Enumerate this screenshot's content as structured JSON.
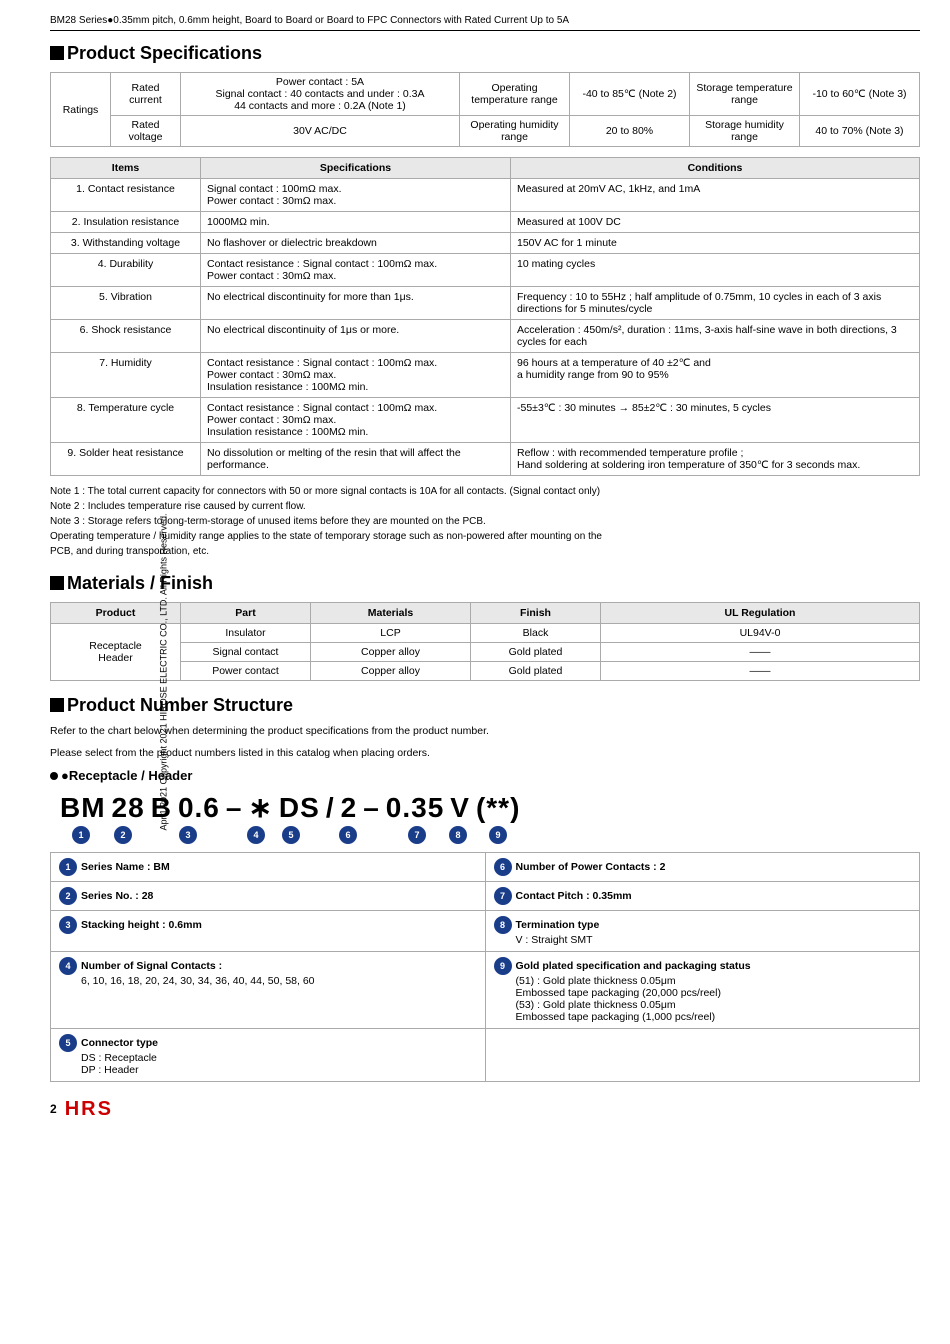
{
  "header": {
    "title": "BM28 Series●0.35mm pitch, 0.6mm height, Board to Board or Board to FPC Connectors with Rated Current Up to 5A"
  },
  "sidebar": {
    "text": "Apr.1.2021 Copyright 2021 HIROSE ELECTRIC CO., LTD. All Rights Reserved."
  },
  "product_specs": {
    "section_title": "Product Specifications",
    "ratings": {
      "rows": [
        {
          "label1": "Rated current",
          "val1": "Power contact : 5A\nSignal contact : 40 contacts and under : 0.3A\n44 contacts and more : 0.2A (Note 1)",
          "label2": "Operating temperature range",
          "val2": "-40 to 85℃ (Note 2)",
          "label3": "Storage temperature range",
          "val3": "-10 to 60℃ (Note 3)"
        },
        {
          "label1": "Rated voltage",
          "val1": "30V AC/DC",
          "label2": "Operating humidity range",
          "val2": "20 to 80%",
          "label3": "Storage humidity range",
          "val3": "40 to 70% (Note 3)"
        }
      ]
    },
    "specs_headers": [
      "Items",
      "Specifications",
      "Conditions"
    ],
    "specs_rows": [
      {
        "item": "1. Contact resistance",
        "spec": "Signal contact : 100mΩ max.\nPower contact : 30mΩ max.",
        "cond": "Measured at 20mV AC, 1kHz, and 1mA"
      },
      {
        "item": "2. Insulation resistance",
        "spec": "1000MΩ min.",
        "cond": "Measured at 100V DC"
      },
      {
        "item": "3. Withstanding voltage",
        "spec": "No flashover or dielectric breakdown",
        "cond": "150V AC for 1 minute"
      },
      {
        "item": "4. Durability",
        "spec": "Contact resistance : Signal contact : 100mΩ max.\nPower contact : 30mΩ max.",
        "cond": "10 mating cycles"
      },
      {
        "item": "5. Vibration",
        "spec": "No electrical discontinuity for more than 1μs.",
        "cond": "Frequency : 10 to 55Hz ; half amplitude of 0.75mm, 10 cycles in each of 3 axis directions for 5 minutes/cycle"
      },
      {
        "item": "6. Shock resistance",
        "spec": "No electrical discontinuity of 1μs or more.",
        "cond": "Acceleration : 450m/s², duration : 11ms, 3-axis half-sine wave in both directions, 3 cycles for each"
      },
      {
        "item": "7. Humidity",
        "spec": "Contact resistance : Signal contact : 100mΩ max.\nPower contact : 30mΩ max.\nInsulation resistance : 100MΩ min.",
        "cond": "96 hours at a temperature of 40 ±2℃ and\na humidity range from 90 to 95%"
      },
      {
        "item": "8. Temperature cycle",
        "spec": "Contact resistance : Signal contact : 100mΩ max.\nPower contact : 30mΩ max.\nInsulation resistance : 100MΩ min.",
        "cond": "-55±3℃ : 30 minutes → 85±2℃ : 30 minutes, 5 cycles"
      },
      {
        "item": "9. Solder heat resistance",
        "spec": "No dissolution or melting of the resin that will affect the performance.",
        "cond": "Reflow : with recommended temperature profile ;\nHand soldering at soldering iron temperature of 350℃ for 3 seconds max."
      }
    ],
    "notes": [
      "Note 1 : The total current capacity for connectors with 50 or more signal contacts is 10A for all contacts. (Signal contact only)",
      "Note 2 : Includes temperature rise caused by current flow.",
      "Note 3 : Storage refers to long-term-storage of unused items before they are mounted on the PCB.",
      "          Operating temperature / humidity range applies to the state of temporary storage such as non-powered after mounting on the",
      "          PCB, and during transportation, etc."
    ]
  },
  "materials": {
    "section_title": "Materials / Finish",
    "headers": [
      "Product",
      "Part",
      "Materials",
      "Finish",
      "UL Regulation"
    ],
    "product_label": "Receptacle\nHeader",
    "rows": [
      {
        "part": "Insulator",
        "materials": "LCP",
        "finish": "Black",
        "ul": "UL94V-0"
      },
      {
        "part": "Signal contact",
        "materials": "Copper alloy",
        "finish": "Gold plated",
        "ul": "——"
      },
      {
        "part": "Power contact",
        "materials": "Copper alloy",
        "finish": "Gold plated",
        "ul": "——"
      }
    ]
  },
  "product_number": {
    "section_title": "Product Number Structure",
    "desc1": "Refer to the chart below when determining the product specifications from the product number.",
    "desc2": "Please select from the product numbers listed in this catalog when placing orders.",
    "receptacle_label": "●Receptacle / Header",
    "part_number_parts": [
      "BM",
      "28",
      "B",
      "0.6",
      "–",
      "*",
      "DS",
      "/",
      "2",
      "–",
      "0.35",
      "V",
      "(**)"
    ],
    "circle_positions": [
      {
        "num": "1",
        "segment": "BM"
      },
      {
        "num": "2",
        "segment": "28"
      },
      {
        "num": "3",
        "segment": "B 0.6"
      },
      {
        "num": "4",
        "segment": "*"
      },
      {
        "num": "5",
        "segment": "DS"
      },
      {
        "num": "6",
        "segment": "2"
      },
      {
        "num": "7",
        "segment": "0.35"
      },
      {
        "num": "8",
        "segment": "V"
      },
      {
        "num": "9",
        "segment": "(**)"
      }
    ],
    "descriptions": [
      {
        "num": "1",
        "label": "Series Name : BM"
      },
      {
        "num": "6",
        "label": "Number of Power Contacts : 2"
      },
      {
        "num": "2",
        "label": "Series No. : 28"
      },
      {
        "num": "7",
        "label": "Contact Pitch : 0.35mm"
      },
      {
        "num": "3",
        "label": "Stacking height : 0.6mm"
      },
      {
        "num": "8",
        "label": "Termination type\nV : Straight SMT"
      },
      {
        "num": "4",
        "label": "Number of Signal Contacts :\n6, 10, 16, 18, 20, 24, 30, 34, 36, 40, 44, 50, 58, 60"
      },
      {
        "num": "9",
        "label": "Gold plated specification and packaging status\n(51) : Gold plate thickness 0.05μm\n       Embossed tape packaging (20,000 pcs/reel)\n(53) : Gold plate thickness 0.05μm\n       Embossed tape packaging (1,000 pcs/reel)"
      },
      {
        "num": "5",
        "label": "Connector type\nDS : Receptacle\nDP : Header"
      }
    ]
  },
  "footer": {
    "page": "2",
    "logo": "HRS"
  }
}
